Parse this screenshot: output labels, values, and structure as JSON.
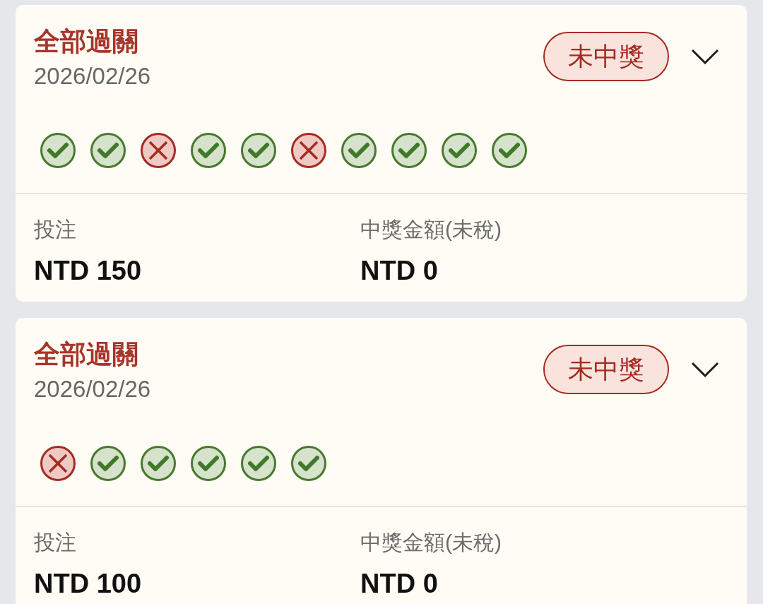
{
  "bets": [
    {
      "title": "全部過關",
      "date": "2026/02/26",
      "status": "未中獎",
      "expanded": false,
      "legs": [
        {
          "won": true
        },
        {
          "won": true
        },
        {
          "won": false
        },
        {
          "won": true
        },
        {
          "won": true
        },
        {
          "won": false
        },
        {
          "won": true
        },
        {
          "won": true
        },
        {
          "won": true
        },
        {
          "won": true
        }
      ],
      "stake_label": "投注",
      "stake": "NTD 150",
      "payout_label": "中獎金額(未稅)",
      "payout": "NTD 0"
    },
    {
      "title": "全部過關",
      "date": "2026/02/26",
      "status": "未中獎",
      "expanded": false,
      "legs": [
        {
          "won": false
        },
        {
          "won": true
        },
        {
          "won": true
        },
        {
          "won": true
        },
        {
          "won": true
        },
        {
          "won": true
        }
      ],
      "stake_label": "投注",
      "stake": "NTD 100",
      "payout_label": "中獎金額(未稅)",
      "payout": "NTD 0"
    }
  ]
}
